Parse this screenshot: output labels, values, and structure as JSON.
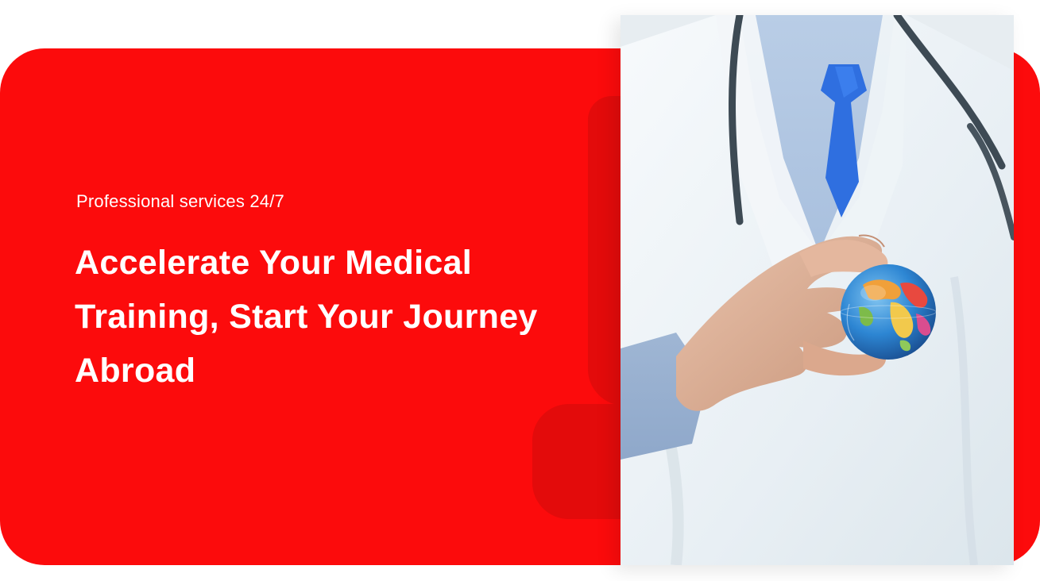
{
  "hero": {
    "eyebrow": "Professional services 24/7",
    "headline": "Accelerate Your Medical Training, Start Your Journey Abroad"
  },
  "photo": {
    "subject": "doctor-holding-globe",
    "icon": "globe-icon"
  },
  "colors": {
    "brand_red": "#fc0b0c",
    "accent_red": "#e30b0b",
    "text": "#ffffff",
    "tie_blue": "#2f6fe0"
  }
}
